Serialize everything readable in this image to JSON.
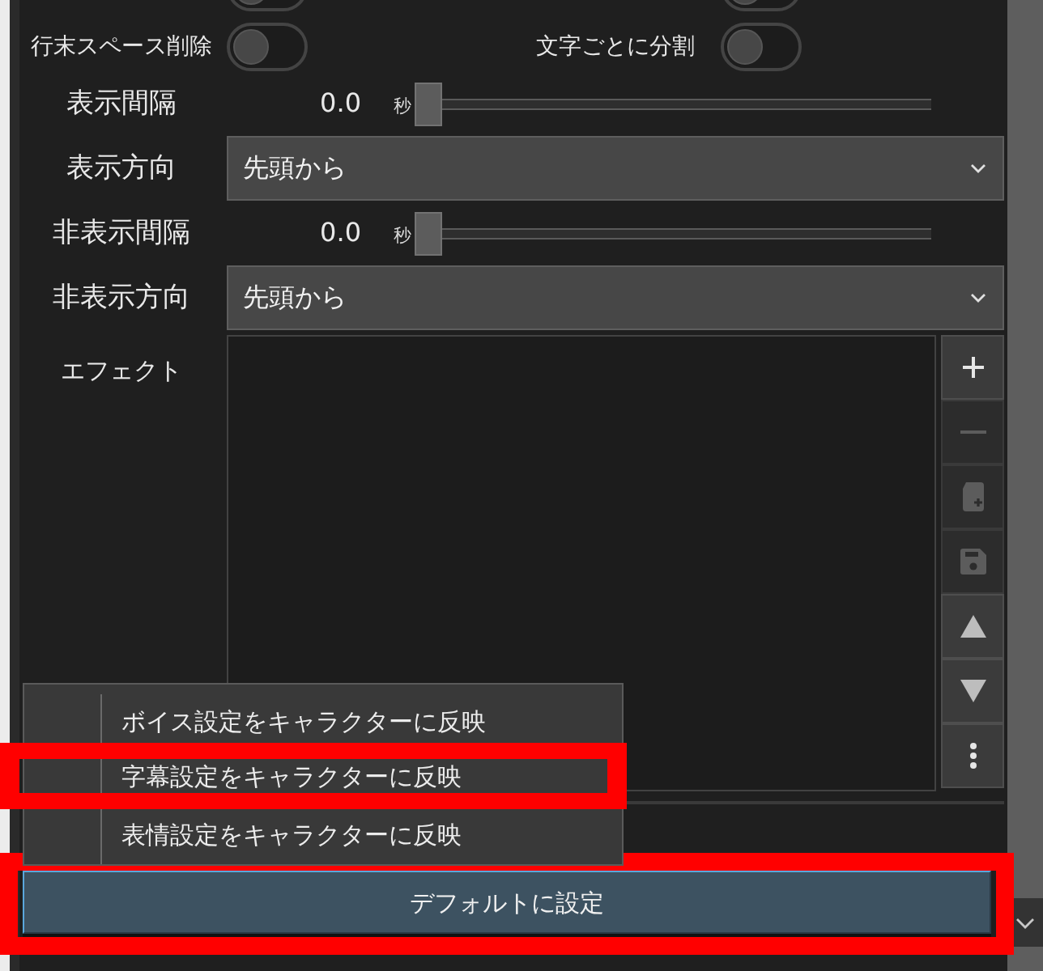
{
  "top_edge_toggles": [
    {
      "on": false
    },
    {
      "on": false
    }
  ],
  "toggles": [
    {
      "label": "行末スペース削除",
      "on": false
    },
    {
      "label": "文字ごとに分割",
      "on": false
    }
  ],
  "settings": [
    {
      "kind": "slider",
      "label": "表示間隔",
      "value": "0.0",
      "unit": "秒",
      "level": 0
    },
    {
      "kind": "select",
      "label": "表示方向",
      "value": "先頭から"
    },
    {
      "kind": "slider",
      "label": "非表示間隔",
      "value": "0.0",
      "unit": "秒",
      "level": 0
    },
    {
      "kind": "select",
      "label": "非表示方向",
      "value": "先頭から"
    }
  ],
  "effects": {
    "label": "エフェクト",
    "toolbar": [
      {
        "kind": "add",
        "disabled": false
      },
      {
        "kind": "remove",
        "disabled": true
      },
      {
        "kind": "new-file",
        "disabled": true
      },
      {
        "kind": "save",
        "disabled": true
      },
      {
        "kind": "move-up",
        "disabled": false
      },
      {
        "kind": "move-down",
        "disabled": false
      },
      {
        "kind": "more",
        "disabled": false
      }
    ]
  },
  "context_menu": {
    "items": [
      {
        "label": "ボイス設定をキャラクターに反映",
        "highlighted": false
      },
      {
        "label": "字幕設定をキャラクターに反映",
        "highlighted": true
      },
      {
        "label": "表情設定をキャラクターに反映",
        "highlighted": false
      }
    ]
  },
  "default_button": {
    "label": "デフォルトに設定",
    "highlighted": true
  }
}
